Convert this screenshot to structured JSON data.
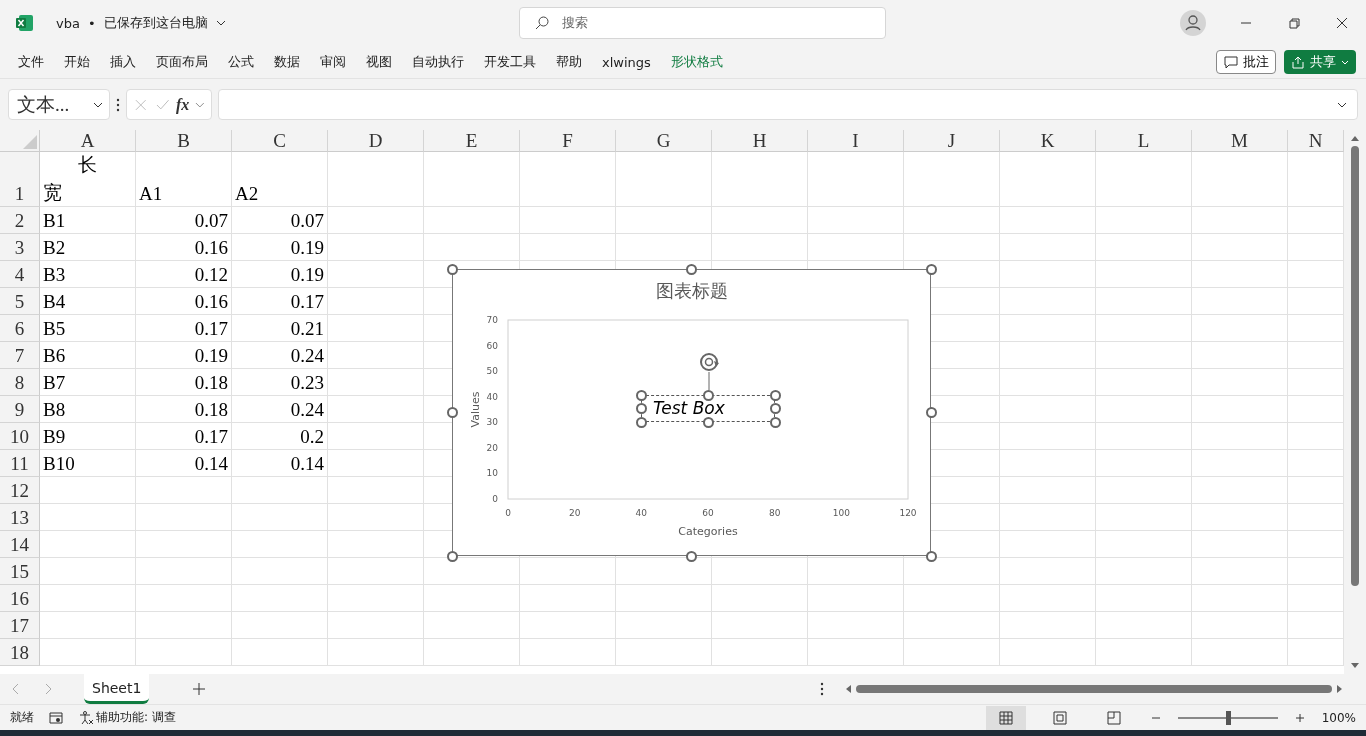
{
  "window": {
    "file_name": "vba",
    "separator": "•",
    "save_status": "已保存到这台电脑",
    "search_placeholder": "搜索"
  },
  "ribbon_tabs": [
    {
      "label": "文件",
      "kind": "normal"
    },
    {
      "label": "开始",
      "kind": "normal"
    },
    {
      "label": "插入",
      "kind": "normal"
    },
    {
      "label": "页面布局",
      "kind": "normal"
    },
    {
      "label": "公式",
      "kind": "normal"
    },
    {
      "label": "数据",
      "kind": "normal"
    },
    {
      "label": "审阅",
      "kind": "normal"
    },
    {
      "label": "视图",
      "kind": "normal"
    },
    {
      "label": "自动执行",
      "kind": "normal"
    },
    {
      "label": "开发工具",
      "kind": "normal"
    },
    {
      "label": "帮助",
      "kind": "normal"
    },
    {
      "label": "xlwings",
      "kind": "normal"
    },
    {
      "label": "形状格式",
      "kind": "contextual"
    }
  ],
  "ribbon_buttons": {
    "comments": "批注",
    "share": "共享"
  },
  "formula_bar": {
    "name_box": "文本...",
    "fx": "fx"
  },
  "columns": [
    "A",
    "B",
    "C",
    "D",
    "E",
    "F",
    "G",
    "H",
    "I",
    "J",
    "K",
    "L",
    "M",
    "N"
  ],
  "rows": [
    {
      "number": "1",
      "cells": [
        {
          "kind": "diagonal",
          "top": "长",
          "bottom": "宽"
        },
        {
          "kind": "text",
          "text": "A1"
        },
        {
          "kind": "text",
          "text": "A2"
        }
      ]
    },
    {
      "number": "2",
      "cells": [
        {
          "kind": "text",
          "text": "B1"
        },
        {
          "kind": "number",
          "text": "0.07"
        },
        {
          "kind": "number",
          "text": "0.07"
        }
      ]
    },
    {
      "number": "3",
      "cells": [
        {
          "kind": "text",
          "text": "B2"
        },
        {
          "kind": "number",
          "text": "0.16"
        },
        {
          "kind": "number",
          "text": "0.19"
        }
      ]
    },
    {
      "number": "4",
      "cells": [
        {
          "kind": "text",
          "text": "B3"
        },
        {
          "kind": "number",
          "text": "0.12"
        },
        {
          "kind": "number",
          "text": "0.19"
        }
      ]
    },
    {
      "number": "5",
      "cells": [
        {
          "kind": "text",
          "text": "B4"
        },
        {
          "kind": "number",
          "text": "0.16"
        },
        {
          "kind": "number",
          "text": "0.17"
        }
      ]
    },
    {
      "number": "6",
      "cells": [
        {
          "kind": "text",
          "text": "B5"
        },
        {
          "kind": "number",
          "text": "0.17"
        },
        {
          "kind": "number",
          "text": "0.21"
        }
      ]
    },
    {
      "number": "7",
      "cells": [
        {
          "kind": "text",
          "text": "B6"
        },
        {
          "kind": "number",
          "text": "0.19"
        },
        {
          "kind": "number",
          "text": "0.24"
        }
      ]
    },
    {
      "number": "8",
      "cells": [
        {
          "kind": "text",
          "text": "B7"
        },
        {
          "kind": "number",
          "text": "0.18"
        },
        {
          "kind": "number",
          "text": "0.23"
        }
      ]
    },
    {
      "number": "9",
      "cells": [
        {
          "kind": "text",
          "text": "B8"
        },
        {
          "kind": "number",
          "text": "0.18"
        },
        {
          "kind": "number",
          "text": "0.24"
        }
      ]
    },
    {
      "number": "10",
      "cells": [
        {
          "kind": "text",
          "text": "B9"
        },
        {
          "kind": "number",
          "text": "0.17"
        },
        {
          "kind": "number",
          "text": "0.2"
        }
      ]
    },
    {
      "number": "11",
      "cells": [
        {
          "kind": "text",
          "text": "B10"
        },
        {
          "kind": "number",
          "text": "0.14"
        },
        {
          "kind": "number",
          "text": "0.14"
        }
      ]
    },
    {
      "number": "12",
      "cells": []
    },
    {
      "number": "13",
      "cells": []
    },
    {
      "number": "14",
      "cells": []
    },
    {
      "number": "15",
      "cells": []
    },
    {
      "number": "16",
      "cells": []
    },
    {
      "number": "17",
      "cells": []
    },
    {
      "number": "18",
      "cells": []
    }
  ],
  "chart": {
    "text_box": "Test Box",
    "chart_data": {
      "type": "scatter",
      "title": "图表标题",
      "xlabel": "Categories",
      "ylabel": "Values",
      "xlim": [
        0,
        120
      ],
      "ylim": [
        0,
        70
      ],
      "xticks": [
        0,
        20,
        40,
        60,
        80,
        100,
        120
      ],
      "yticks": [
        0,
        10,
        20,
        30,
        40,
        50,
        60,
        70
      ]
    }
  },
  "sheet_tabs": [
    {
      "label": "Sheet1",
      "selected": true
    }
  ],
  "status_bar": {
    "ready": "就绪",
    "accessibility": "辅助功能: 调查",
    "zoom": "100%",
    "zoom_slider": {
      "level": 0.5
    },
    "views": [
      {
        "kind": "normal",
        "selected": true
      },
      {
        "kind": "page-layout",
        "selected": false
      },
      {
        "kind": "page-break",
        "selected": false
      }
    ]
  }
}
